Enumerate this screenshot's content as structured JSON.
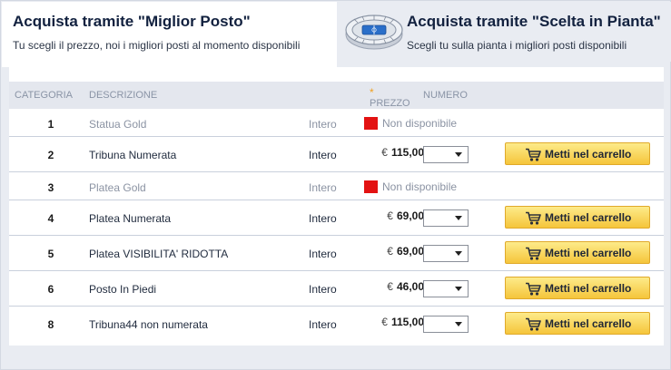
{
  "tabs": {
    "best": {
      "title": "Acquista tramite \"Miglior Posto\"",
      "subtitle": "Tu scegli il prezzo, noi i migliori posti al momento disponibili"
    },
    "map": {
      "title": "Acquista tramite \"Scelta in Pianta\"",
      "subtitle": "Scegli tu sulla pianta i migliori posti disponibili",
      "icon": "stadium-icon"
    }
  },
  "table": {
    "headers": {
      "category": "CATEGORIA",
      "description": "DESCRIZIONE",
      "price": "PREZZO",
      "price_note": "*",
      "number": "NUMERO"
    },
    "currency": "€",
    "cart_label": "Metti nel carrello",
    "unavailable_label": "Non disponibile",
    "rows": [
      {
        "category": "1",
        "description": "Statua Gold",
        "type": "Intero",
        "price": "",
        "available": false
      },
      {
        "category": "2",
        "description": "Tribuna Numerata",
        "type": "Intero",
        "price": "115,00",
        "available": true
      },
      {
        "category": "3",
        "description": "Platea Gold",
        "type": "Intero",
        "price": "",
        "available": false
      },
      {
        "category": "4",
        "description": "Platea Numerata",
        "type": "Intero",
        "price": "69,00",
        "available": true
      },
      {
        "category": "5",
        "description": "Platea VISIBILITA' RIDOTTA",
        "type": "Intero",
        "price": "69,00",
        "available": true
      },
      {
        "category": "6",
        "description": "Posto In Piedi",
        "type": "Intero",
        "price": "46,00",
        "available": true
      },
      {
        "category": "8",
        "description": "Tribuna44 non numerata",
        "type": "Intero",
        "price": "115,00",
        "available": true
      }
    ]
  },
  "colors": {
    "title": "#12213f",
    "unavailable": "#e31212",
    "button_top": "#fdeb8a",
    "button_bottom": "#f5c53b",
    "row_divider": "#c9d0dc"
  }
}
